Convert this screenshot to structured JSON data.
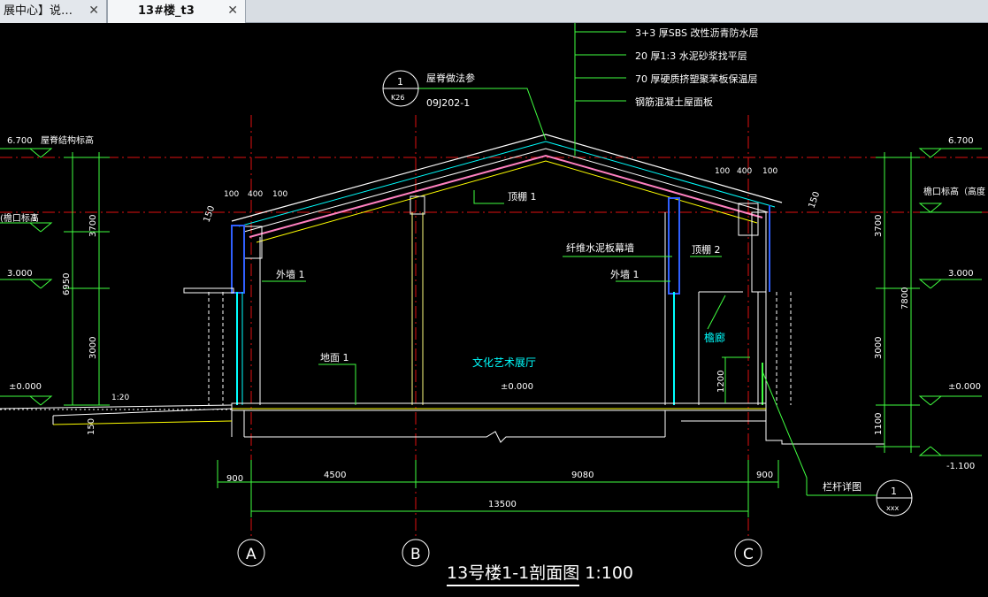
{
  "tabs": [
    {
      "label": "展中心】说…",
      "close": "✕"
    },
    {
      "label": "13#楼_t3",
      "close": "✕"
    }
  ],
  "drawing": {
    "title": "13号楼1-1剖面图 1:100",
    "notes": [
      "3+3  厚SBS 改性沥青防水层",
      "20 厚1:3  水泥砂浆找平层",
      "70 厚硬质挤塑聚苯板保温层",
      "钢筋混凝土屋面板"
    ],
    "ridge_detail": {
      "num": "1",
      "sheet": "K26",
      "label": "屋脊做法参",
      "ref": "09J202-1"
    },
    "rail_detail": {
      "num": "1",
      "sheet": "xxx",
      "label": "栏杆详图"
    },
    "left_elevations": [
      "6.700",
      "屋脊结构标高",
      "±0.000",
      "3.000",
      "檐口标高（高度"
    ],
    "left_small": [
      "(檐口标高",
      "1"
    ],
    "right_elevations": [
      "6.700",
      "檐口标高（高度",
      "3.000",
      "±0.000",
      "-1.100"
    ],
    "left_dims": [
      "3700",
      "6950",
      "3000",
      "150"
    ],
    "right_dims": [
      "3700",
      "7800",
      "3000",
      "1100"
    ],
    "roof_dims": [
      "100",
      "400",
      "100",
      "100",
      "400",
      "100",
      "150",
      "150"
    ],
    "room_labels": [
      "顶棚 1",
      "顶棚 2",
      "外墙 1",
      "外墙 1",
      "纤维水泥板幕墙",
      "地面 1",
      "文化艺术展厅",
      "±0.000",
      "檐廊",
      "1200",
      "1:20"
    ],
    "axis_dims": [
      "900",
      "4500",
      "9080",
      "900",
      "13500"
    ],
    "axes": [
      "A",
      "B",
      "C"
    ]
  }
}
